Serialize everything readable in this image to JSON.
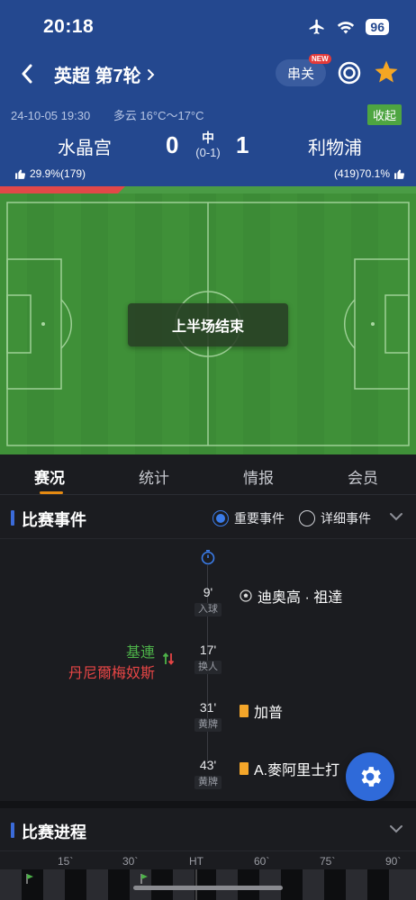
{
  "status_bar": {
    "time": "20:18",
    "battery": "96"
  },
  "nav": {
    "league": "英超 第7轮",
    "chuanguan": "串关",
    "new_tag": "NEW"
  },
  "match": {
    "datetime": "24-10-05 19:30",
    "weather": "多云 16°C～17°C",
    "collapse_label": "收起",
    "home_team": "水晶宫",
    "away_team": "利物浦",
    "home_score": "0",
    "away_score": "1",
    "status": "中",
    "half_score": "(0-1)",
    "home_vote": "29.9%(179)",
    "away_vote": "(419)70.1%",
    "home_prob": 0.3,
    "pitch_banner": "上半场结束"
  },
  "tabs": [
    "赛况",
    "统计",
    "情报",
    "会员"
  ],
  "events_section": {
    "title": "比赛事件",
    "option_important": "重要事件",
    "option_detail": "详细事件",
    "events": [
      {
        "minute": "9'",
        "tag": "入球",
        "player": "迪奥高 · 祖達"
      },
      {
        "minute": "17'",
        "tag": "换人",
        "player_in": "基連",
        "player_out": "丹尼爾梅奴斯"
      },
      {
        "minute": "31'",
        "tag": "黄牌",
        "player": "加普"
      },
      {
        "minute": "43'",
        "tag": "黄牌",
        "player": "A.麥阿里士打"
      }
    ]
  },
  "progress_section": {
    "title": "比赛进程",
    "ticks": [
      "15`",
      "30`",
      "HT",
      "60`",
      "75`",
      "90`"
    ]
  },
  "colors": {
    "header": "#24488f",
    "pitch": "#3c8b36",
    "accent": "#e58a12",
    "win_red": "#e14848",
    "yellow_card": "#f4a62a"
  }
}
